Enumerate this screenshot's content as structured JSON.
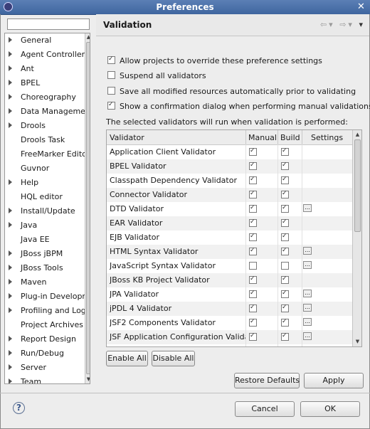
{
  "window": {
    "title": "Preferences"
  },
  "filter": {
    "placeholder": ""
  },
  "tree": {
    "items": [
      {
        "label": "General",
        "expandable": true
      },
      {
        "label": "Agent Controller",
        "expandable": true
      },
      {
        "label": "Ant",
        "expandable": true
      },
      {
        "label": "BPEL",
        "expandable": true
      },
      {
        "label": "Choreography",
        "expandable": true
      },
      {
        "label": "Data Management",
        "expandable": true
      },
      {
        "label": "Drools",
        "expandable": true
      },
      {
        "label": "Drools Task",
        "expandable": false
      },
      {
        "label": "FreeMarker Editor",
        "expandable": false
      },
      {
        "label": "Guvnor",
        "expandable": false
      },
      {
        "label": "Help",
        "expandable": true
      },
      {
        "label": "HQL editor",
        "expandable": false
      },
      {
        "label": "Install/Update",
        "expandable": true
      },
      {
        "label": "Java",
        "expandable": true
      },
      {
        "label": "Java EE",
        "expandable": false
      },
      {
        "label": "JBoss jBPM",
        "expandable": true
      },
      {
        "label": "JBoss Tools",
        "expandable": true
      },
      {
        "label": "Maven",
        "expandable": true
      },
      {
        "label": "Plug-in Development",
        "expandable": true
      },
      {
        "label": "Profiling and Logging",
        "expandable": true
      },
      {
        "label": "Project Archives",
        "expandable": false
      },
      {
        "label": "Report Design",
        "expandable": true
      },
      {
        "label": "Run/Debug",
        "expandable": true
      },
      {
        "label": "Server",
        "expandable": true
      },
      {
        "label": "Team",
        "expandable": true
      }
    ]
  },
  "page": {
    "title": "Validation",
    "options": [
      {
        "label": "Allow projects to override these preference settings",
        "checked": true
      },
      {
        "label": "Suspend all validators",
        "checked": false
      },
      {
        "label": "Save all modified resources automatically prior to validating",
        "checked": false
      },
      {
        "label": "Show a confirmation dialog when performing manual validations",
        "checked": true
      }
    ],
    "selected_label": "The selected validators will run when validation is performed:",
    "columns": {
      "validator": "Validator",
      "manual": "Manual",
      "build": "Build",
      "settings": "Settings"
    },
    "validators": [
      {
        "name": "Application Client Validator",
        "manual": true,
        "build": true,
        "settings": false
      },
      {
        "name": "BPEL Validator",
        "manual": true,
        "build": true,
        "settings": false
      },
      {
        "name": "Classpath Dependency Validator",
        "manual": true,
        "build": true,
        "settings": false
      },
      {
        "name": "Connector Validator",
        "manual": true,
        "build": true,
        "settings": false
      },
      {
        "name": "DTD Validator",
        "manual": true,
        "build": true,
        "settings": true
      },
      {
        "name": "EAR Validator",
        "manual": true,
        "build": true,
        "settings": false
      },
      {
        "name": "EJB Validator",
        "manual": true,
        "build": true,
        "settings": false
      },
      {
        "name": "HTML Syntax Validator",
        "manual": true,
        "build": true,
        "settings": true
      },
      {
        "name": "JavaScript Syntax Validator",
        "manual": false,
        "build": false,
        "settings": true
      },
      {
        "name": "JBoss KB Project Validator",
        "manual": true,
        "build": true,
        "settings": false
      },
      {
        "name": "JPA Validator",
        "manual": true,
        "build": true,
        "settings": true
      },
      {
        "name": "jPDL 4 Validator",
        "manual": true,
        "build": true,
        "settings": true
      },
      {
        "name": "JSF2 Components Validator",
        "manual": true,
        "build": true,
        "settings": true
      },
      {
        "name": "JSF Application Configuration Validator",
        "manual": true,
        "build": true,
        "settings": true
      },
      {
        "name": "",
        "manual": true,
        "build": true,
        "settings": true
      }
    ],
    "enable_all": "Enable All",
    "disable_all": "Disable All",
    "restore_defaults": "Restore Defaults",
    "apply": "Apply"
  },
  "footer": {
    "cancel": "Cancel",
    "ok": "OK",
    "help_glyph": "?"
  }
}
